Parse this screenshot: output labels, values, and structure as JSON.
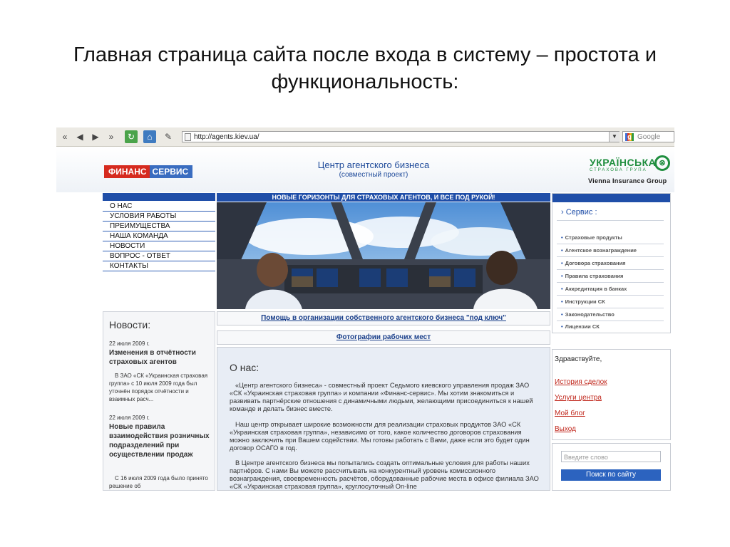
{
  "slide": {
    "title_line1": "Главная страница сайта после входа в систему – простота и",
    "title_line2": "функциональность:"
  },
  "browser": {
    "url": "http://agents.kiev.ua/",
    "search_engine": "Google",
    "buttons": [
      "back-all",
      "back",
      "forward",
      "forward-all",
      "reload",
      "home",
      "tools"
    ]
  },
  "header": {
    "logo_part1": "ФИНАНС",
    "logo_part2": "СЕРВИС",
    "title": "Центр агентского бизнеса",
    "subtitle": "(совместный проект)",
    "partner_name": "УКРАЇНСЬКА",
    "partner_sub": "СТРАХОВА ГРУПА",
    "partner_group": "Vienna Insurance Group"
  },
  "nav": {
    "items": [
      "О НАС",
      "УСЛОВИЯ РАБОТЫ",
      "ПРЕИМУЩЕСТВА",
      "НАША КОМАНДА",
      "НОВОСТИ",
      "ВОПРОС - ОТВЕТ",
      "КОНТАКТЫ"
    ]
  },
  "banner": "НОВЫЕ ГОРИЗОНТЫ ДЛЯ СТРАХОВЫХ АГЕНТОВ, И ВСЕ ПОД РУКОЙ!",
  "links": {
    "turnkey": "Помощь в организации собственного агентского бизнеса \"под ключ\"",
    "photos": "Фотографии рабочих мест"
  },
  "news": {
    "heading": "Новости:",
    "items": [
      {
        "date": "22 июля 2009 г.",
        "title": "Изменения в отчётности страховых агентов",
        "text": "В ЗАО «СК «Украинская страховая группа» с 10 июля 2009 года был уточнён порядок отчётности и взаимных расч..."
      },
      {
        "date": "22 июля 2009 г.",
        "title": "Новые правила взаимодействия розничных подразделений при осуществлении продаж",
        "text": "С 16 июля 2009 года было принято решение об"
      }
    ]
  },
  "about": {
    "heading": "О нас:",
    "p1": "«Центр агентского бизнеса» - совместный проект Седьмого киевского управления продаж ЗАО «СК «Украинская страховая группа» и компании «Финанс-сервис». Мы хотим знакомиться и развивать партнёрские отношения с динамичными людьми, желающими присоединиться к нашей команде и делать бизнес вместе.",
    "p2": "Наш центр открывает широкие возможности для реализации страховых продуктов ЗАО «СК «Украинская страховая группа», независимо от того, какое количество договоров страхования можно заключить при Вашем содействии. Мы готовы работать с Вами, даже если это будет один договор ОСАГО в год.",
    "p3": "В Центре агентского бизнеса мы попытались создать оптимальные условия для работы наших партнёров. С нами Вы можете рассчитывать на конкурентный уровень комиссионного вознаграждения, своевременность расчётов, оборудованные рабочие места в офисе филиала ЗАО «СК «Украинская страховая группа», круглосуточный On-line"
  },
  "service": {
    "heading": "› Сервис :",
    "items": [
      "Страховые продукты",
      "Агентское вознаграждение",
      "Договора страхования",
      "Правила страхования",
      "Аккредитация в банках",
      "Инструкции СК",
      "Законодательство",
      "Лицензии СК"
    ]
  },
  "user": {
    "greeting": "Здравствуйте,",
    "links": [
      "История сделок",
      "Услуги центра",
      "Мой блог",
      "Выход"
    ]
  },
  "site_search": {
    "placeholder": "Введите слово",
    "button": "Поиск по сайту"
  },
  "colors": {
    "nav_blue": "#1f4ea8",
    "logo_red": "#d62b1f",
    "partner_green": "#1f8e3e",
    "link_red": "#c0261b"
  }
}
